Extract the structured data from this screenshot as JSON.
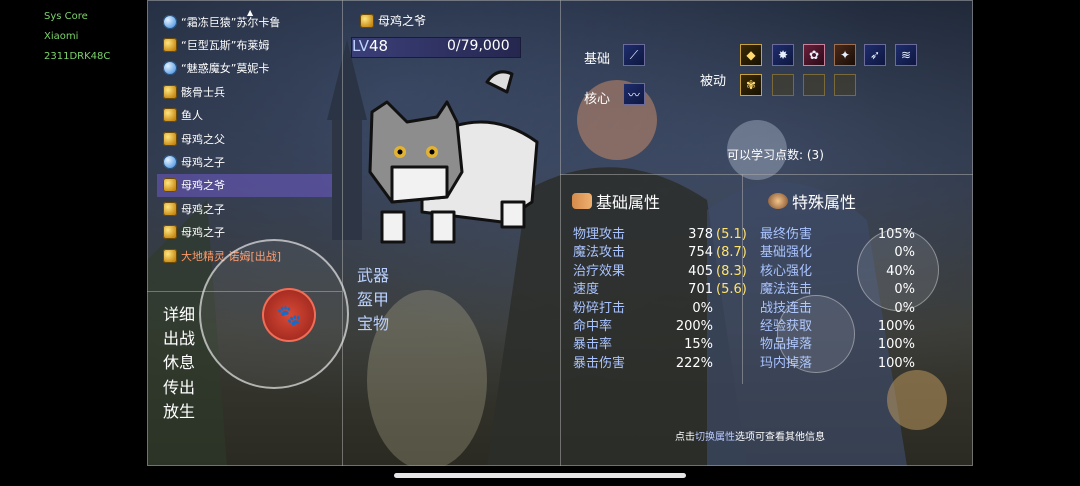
{
  "status": {
    "line1": "Sys Core",
    "line2": "Xiaomi",
    "line3": "2311DRK48C"
  },
  "roster": [
    {
      "label": "“霜冻巨猿”苏尔卡鲁",
      "icon": "blue-paw-icon",
      "selected": false,
      "mate": false
    },
    {
      "label": "“巨型瓦斯”布莱姆",
      "icon": "gold-paw-icon",
      "selected": false,
      "mate": false
    },
    {
      "label": "“魅惑魔女”莫妮卡",
      "icon": "blue-paw-icon",
      "selected": false,
      "mate": false
    },
    {
      "label": "骸骨士兵",
      "icon": "gold-paw-icon",
      "selected": false,
      "mate": false
    },
    {
      "label": "鱼人",
      "icon": "gold-paw-icon",
      "selected": false,
      "mate": false
    },
    {
      "label": "母鸡之父",
      "icon": "gold-paw-icon",
      "selected": false,
      "mate": false
    },
    {
      "label": "母鸡之子",
      "icon": "blue-paw-icon",
      "selected": false,
      "mate": false
    },
    {
      "label": "母鸡之爷",
      "icon": "gold-paw-icon",
      "selected": true,
      "mate": false
    },
    {
      "label": "母鸡之子",
      "icon": "gold-paw-icon",
      "selected": false,
      "mate": false
    },
    {
      "label": "母鸡之子",
      "icon": "gold-paw-icon",
      "selected": false,
      "mate": false
    },
    {
      "label": "大地精灵 诺姆[出战]",
      "icon": "gold-paw-icon",
      "selected": false,
      "mate": true
    }
  ],
  "actions": [
    "详细",
    "出战",
    "休息",
    "传出",
    "放生"
  ],
  "pet": {
    "name": "母鸡之爷",
    "level_prefix": "LV",
    "level": "48",
    "xp": "0/79,000",
    "tabs": [
      "武器",
      "盔甲",
      "宝物"
    ]
  },
  "skills": {
    "basic_label": "基础",
    "core_label": "核心",
    "passive_label": "被动",
    "points_label": "可以学习点数:",
    "points_value": "(3)"
  },
  "basic_stats": {
    "title": "基础属性",
    "rows": [
      {
        "k": "物理攻击",
        "v": "378",
        "g": "(5.1)"
      },
      {
        "k": "魔法攻击",
        "v": "754",
        "g": "(8.7)"
      },
      {
        "k": "治疗效果",
        "v": "405",
        "g": "(8.3)"
      },
      {
        "k": "速度",
        "v": "701",
        "g": "(5.6)"
      },
      {
        "k": "粉碎打击",
        "v": "0%",
        "g": ""
      },
      {
        "k": "命中率",
        "v": "200%",
        "g": ""
      },
      {
        "k": "暴击率",
        "v": "15%",
        "g": ""
      },
      {
        "k": "暴击伤害",
        "v": "222%",
        "g": ""
      }
    ]
  },
  "special_stats": {
    "title": "特殊属性",
    "rows": [
      {
        "k": "最终伤害",
        "v": "105%"
      },
      {
        "k": "基础强化",
        "v": "0%"
      },
      {
        "k": "核心强化",
        "v": "40%"
      },
      {
        "k": "魔法连击",
        "v": "0%"
      },
      {
        "k": "战技连击",
        "v": "0%"
      },
      {
        "k": "经验获取",
        "v": "100%"
      },
      {
        "k": "物品掉落",
        "v": "100%"
      },
      {
        "k": "玛内掉落",
        "v": "100%"
      }
    ]
  },
  "hint": {
    "prefix": "点击",
    "highlight": "切换属性",
    "suffix": "选项可查看其他信息"
  },
  "colors": {
    "selected_row": "#6e5ac8",
    "gold_value": "#ffe36a",
    "label_blue": "#a9c3ff",
    "mate_orange": "#ff9a6a"
  }
}
